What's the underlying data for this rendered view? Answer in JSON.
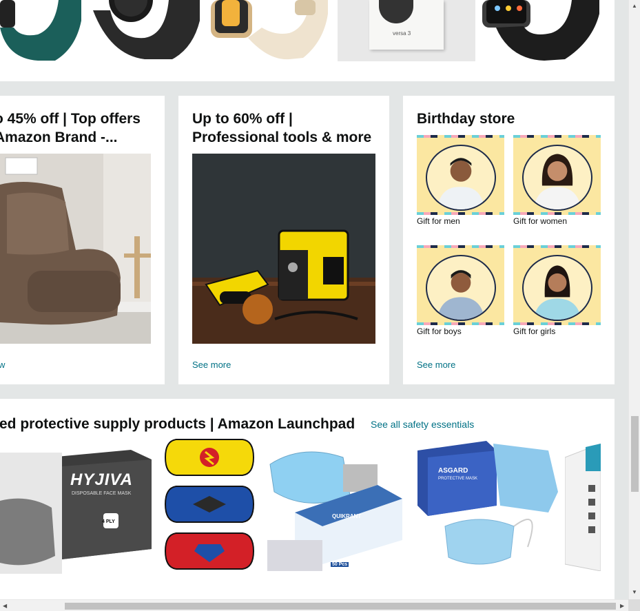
{
  "cards": [
    {
      "title_line1": "o 45% off | Top offers",
      "title_line2": " Amazon Brand -...",
      "see_more": "w"
    },
    {
      "title_line1": "Up to 60% off |",
      "title_line2": "Professional tools & more",
      "see_more": "See more"
    },
    {
      "title": "Birthday store",
      "see_more": "See more",
      "tiles": [
        {
          "label": "Gift for men"
        },
        {
          "label": "Gift for women"
        },
        {
          "label": "Gift for boys"
        },
        {
          "label": "Gift for girls"
        }
      ]
    }
  ],
  "safety": {
    "title": "ted protective supply products | Amazon Launchpad",
    "see_all": "See all safety essentials",
    "product_texts": {
      "hyjiva_brand": "HYJIVA",
      "hyjiva_sub": "DISPOSABLE FACE MASK",
      "hyjiva_ply": "4 PLY",
      "quikrant_brand": "QUIKRANT",
      "quikrant_count": "50 Pcs",
      "asgard_brand": "ASGARD",
      "asgard_sub": "PROTECTIVE MASK"
    }
  },
  "top_strip": {
    "versa_text": "versa 3"
  },
  "colors": {
    "link": "#007185",
    "page_bg": "#e3e6e6",
    "card_bg": "#ffffff"
  }
}
